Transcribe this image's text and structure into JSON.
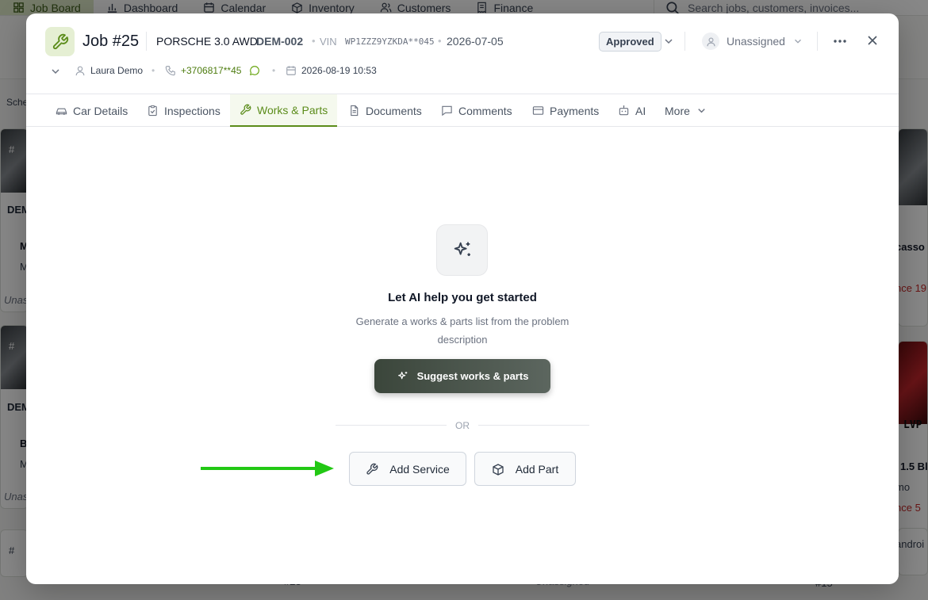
{
  "background_nav": {
    "items": [
      {
        "label": "Job Board",
        "icon": "grid-icon"
      },
      {
        "label": "Dashboard",
        "icon": "bar-chart-icon"
      },
      {
        "label": "Calendar",
        "icon": "calendar-icon"
      },
      {
        "label": "Inventory",
        "icon": "box-icon"
      },
      {
        "label": "Customers",
        "icon": "users-icon"
      },
      {
        "label": "Finance",
        "icon": "receipt-icon"
      }
    ],
    "search_placeholder": "Search jobs, customers, invoices..."
  },
  "background_board": {
    "left_tab": "Sche",
    "cards": [
      {
        "handle": "#",
        "plate": "DEM",
        "line1": "M",
        "line2": "M",
        "assignee": "Unas"
      },
      {
        "handle": "#",
        "plate": "DEM",
        "line1": "B",
        "line2": "M",
        "assignee": "Unas"
      },
      {
        "handle": "#"
      }
    ],
    "right_cards": [
      {
        "title": "casso",
        "status": "nce 19"
      },
      {
        "title": "1.5 Bl",
        "subtitle": "mo",
        "status": "nce 5",
        "plate": "LVP"
      },
      {
        "title": "androi"
      }
    ],
    "bottom": {
      "card_23": "#23",
      "card_15": "#15",
      "unassigned": "Unassigned"
    }
  },
  "job": {
    "title": "Job #25",
    "car": "PORSCHE 3.0 AWD",
    "plate": "DEM-002",
    "vin_label": "VIN",
    "vin": "WP1ZZZ9YZKDA**045",
    "date": "2026-07-05",
    "status": "Approved",
    "assignee": "Unassigned",
    "customer": "Laura Demo",
    "phone": "+3706817**45",
    "appointment": "2026-08-19 10:53"
  },
  "tabs": [
    {
      "label": "Car Details",
      "icon": "car-icon"
    },
    {
      "label": "Inspections",
      "icon": "clipboard-check-icon"
    },
    {
      "label": "Works & Parts",
      "icon": "wrench-icon",
      "active": true
    },
    {
      "label": "Documents",
      "icon": "document-icon"
    },
    {
      "label": "Comments",
      "icon": "comment-icon"
    },
    {
      "label": "Payments",
      "icon": "credit-card-icon"
    },
    {
      "label": "AI",
      "icon": "robot-icon"
    },
    {
      "label": "More",
      "icon": "chevron-down-icon"
    }
  ],
  "empty_state": {
    "title": "Let AI help you get started",
    "description": "Generate a works & parts list from the problem description",
    "suggest_button": "Suggest works & parts",
    "or_label": "OR",
    "add_service": "Add Service",
    "add_part": "Add Part"
  },
  "colors": {
    "accent": "#5b8c1a",
    "arrow": "#22c814",
    "suggest_button_bg": "#3b463b"
  }
}
